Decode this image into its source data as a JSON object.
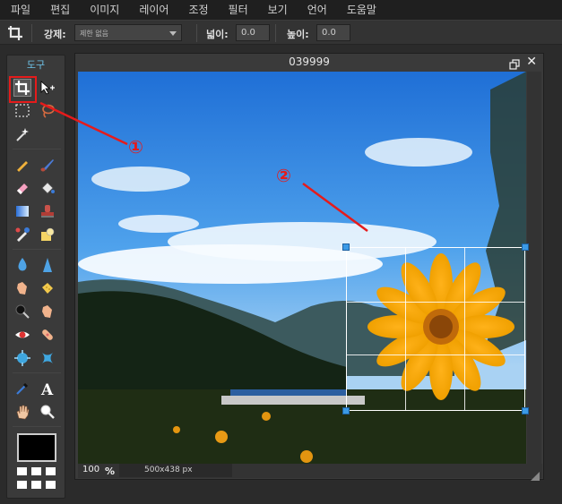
{
  "menu": [
    "파일",
    "편집",
    "이미지",
    "레이어",
    "조정",
    "필터",
    "보기",
    "언어",
    "도움말"
  ],
  "options": {
    "constraint_label": "강제:",
    "constraint_value": "제한 없음",
    "width_label": "넓이:",
    "width_value": "0.0",
    "height_label": "높이:",
    "height_value": "0.0"
  },
  "tools_panel": {
    "title": "도구",
    "tools": [
      "crop-icon",
      "move-icon",
      "marquee-icon",
      "lasso-icon",
      "magic-wand-icon",
      "pencil-icon",
      "brush-icon",
      "eraser-icon",
      "paint-bucket-icon",
      "gradient-icon",
      "stamp-icon",
      "color-replace-icon",
      "drawing-icon",
      "blur-icon",
      "sharpen-icon",
      "smudge-icon",
      "sponge-icon",
      "dodge-icon",
      "burn-icon",
      "red-eye-icon",
      "spot-heal-icon",
      "bloat-icon",
      "pinch-icon",
      "color-picker-icon",
      "text-icon",
      "hand-icon",
      "zoom-icon"
    ]
  },
  "canvas": {
    "title": "039999",
    "zoom": "100",
    "zoom_unit": "%",
    "size": "500x438 px"
  },
  "annotations": {
    "marker1": "①",
    "marker2": "②",
    "color": "#e51b1b"
  },
  "colors": {
    "accent": "#6ec3e8",
    "crop_handle": "#3b9ae6",
    "foreground": "#000000"
  }
}
